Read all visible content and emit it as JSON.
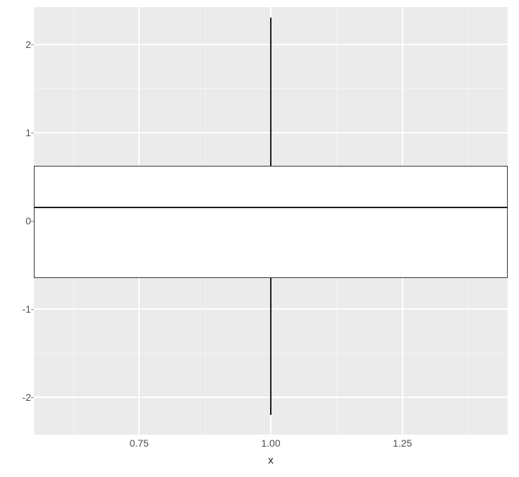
{
  "chart_data": {
    "type": "boxplot",
    "x_category": 1.0,
    "box": {
      "lower_whisker": -2.2,
      "q1": -0.65,
      "median": 0.15,
      "q3": 0.62,
      "upper_whisker": 2.3
    },
    "xlabel": "x",
    "ylabel": "",
    "x_ticks": [
      0.75,
      1.0,
      1.25
    ],
    "x_tick_labels": [
      "0.75",
      "1.00",
      "1.25"
    ],
    "y_ticks": [
      -2,
      -1,
      0,
      1,
      2
    ],
    "y_tick_labels": [
      "-2",
      "-1",
      "0",
      "1",
      "2"
    ],
    "xlim": [
      0.55,
      1.45
    ],
    "ylim": [
      -2.42,
      2.42
    ],
    "grid": true,
    "panel_bg": "#ebebeb"
  }
}
